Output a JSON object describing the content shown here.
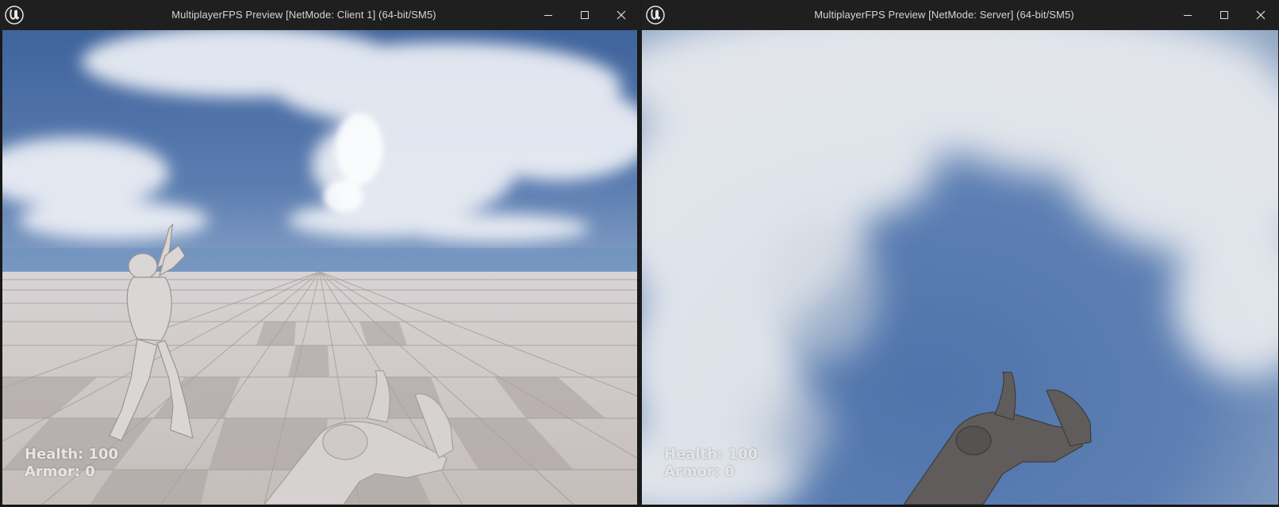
{
  "windows": [
    {
      "title": "MultiplayerFPS Preview [NetMode: Client 1]  (64-bit/SM5)",
      "hud": {
        "health": "Health: 100",
        "armor": "Armor: 0"
      },
      "logo_icon": "unreal-engine-logo",
      "controls": [
        "minimize-icon",
        "maximize-icon",
        "close-icon"
      ]
    },
    {
      "title": "MultiplayerFPS Preview [NetMode: Server]  (64-bit/SM5)",
      "hud": {
        "health": "Health: 100",
        "armor": "Armor: 0"
      },
      "logo_icon": "unreal-engine-logo",
      "controls": [
        "minimize-icon",
        "maximize-icon",
        "close-icon"
      ]
    }
  ],
  "colors": {
    "titlebar": "#1f1f1f",
    "sky_blue": "#4f72a6",
    "floor_light": "#cfc8c6",
    "floor_dark": "#b3aba9",
    "hud_text": "#e6e6e6"
  }
}
